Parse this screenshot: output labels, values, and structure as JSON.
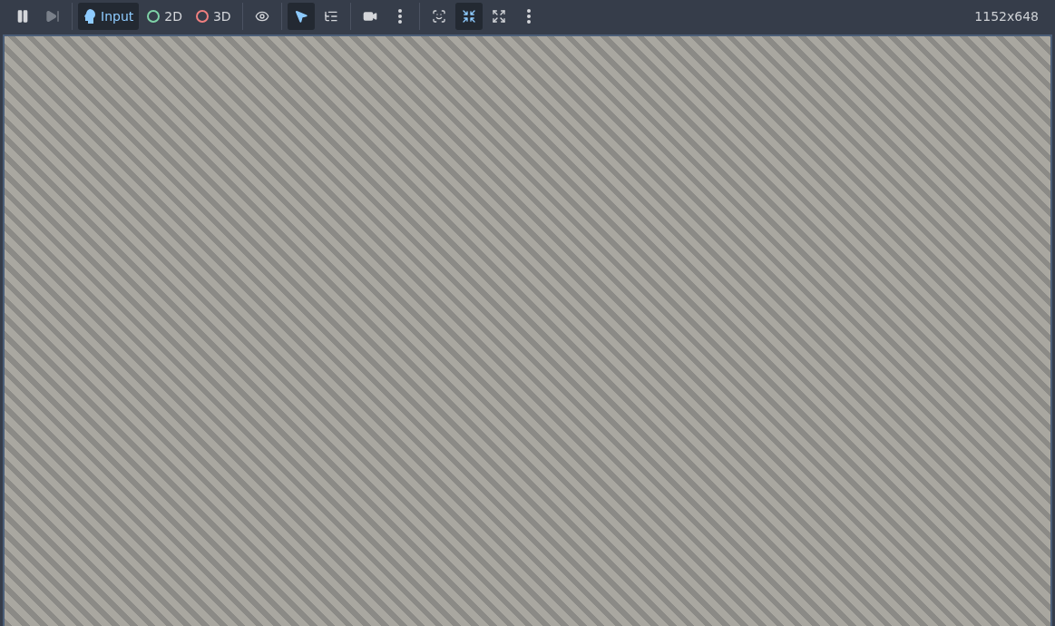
{
  "toolbar": {
    "groups": [
      {
        "buttons": [
          {
            "kind": "pause",
            "selected": false,
            "disabled": false
          },
          {
            "kind": "step",
            "selected": false,
            "disabled": true
          }
        ]
      },
      {
        "buttons": [
          {
            "kind": "input",
            "label": "Input",
            "selected": true,
            "disabled": false
          },
          {
            "kind": "twod",
            "label": "2D",
            "selected": false,
            "disabled": false
          },
          {
            "kind": "threed",
            "label": "3D",
            "selected": false,
            "disabled": false
          }
        ]
      },
      {
        "buttons": [
          {
            "kind": "eye",
            "selected": false,
            "disabled": false
          }
        ]
      },
      {
        "buttons": [
          {
            "kind": "select",
            "selected": true,
            "disabled": false
          },
          {
            "kind": "list-select",
            "selected": false,
            "disabled": false
          }
        ]
      },
      {
        "buttons": [
          {
            "kind": "camera",
            "selected": false,
            "disabled": false
          },
          {
            "kind": "menu",
            "selected": false,
            "disabled": false
          }
        ]
      },
      {
        "buttons": [
          {
            "kind": "lock-frame",
            "selected": false,
            "disabled": false
          },
          {
            "kind": "shrink",
            "selected": true,
            "disabled": false
          },
          {
            "kind": "expand",
            "selected": false,
            "disabled": false
          },
          {
            "kind": "menu",
            "selected": false,
            "disabled": false
          }
        ]
      }
    ],
    "resolution": "1152x648"
  }
}
